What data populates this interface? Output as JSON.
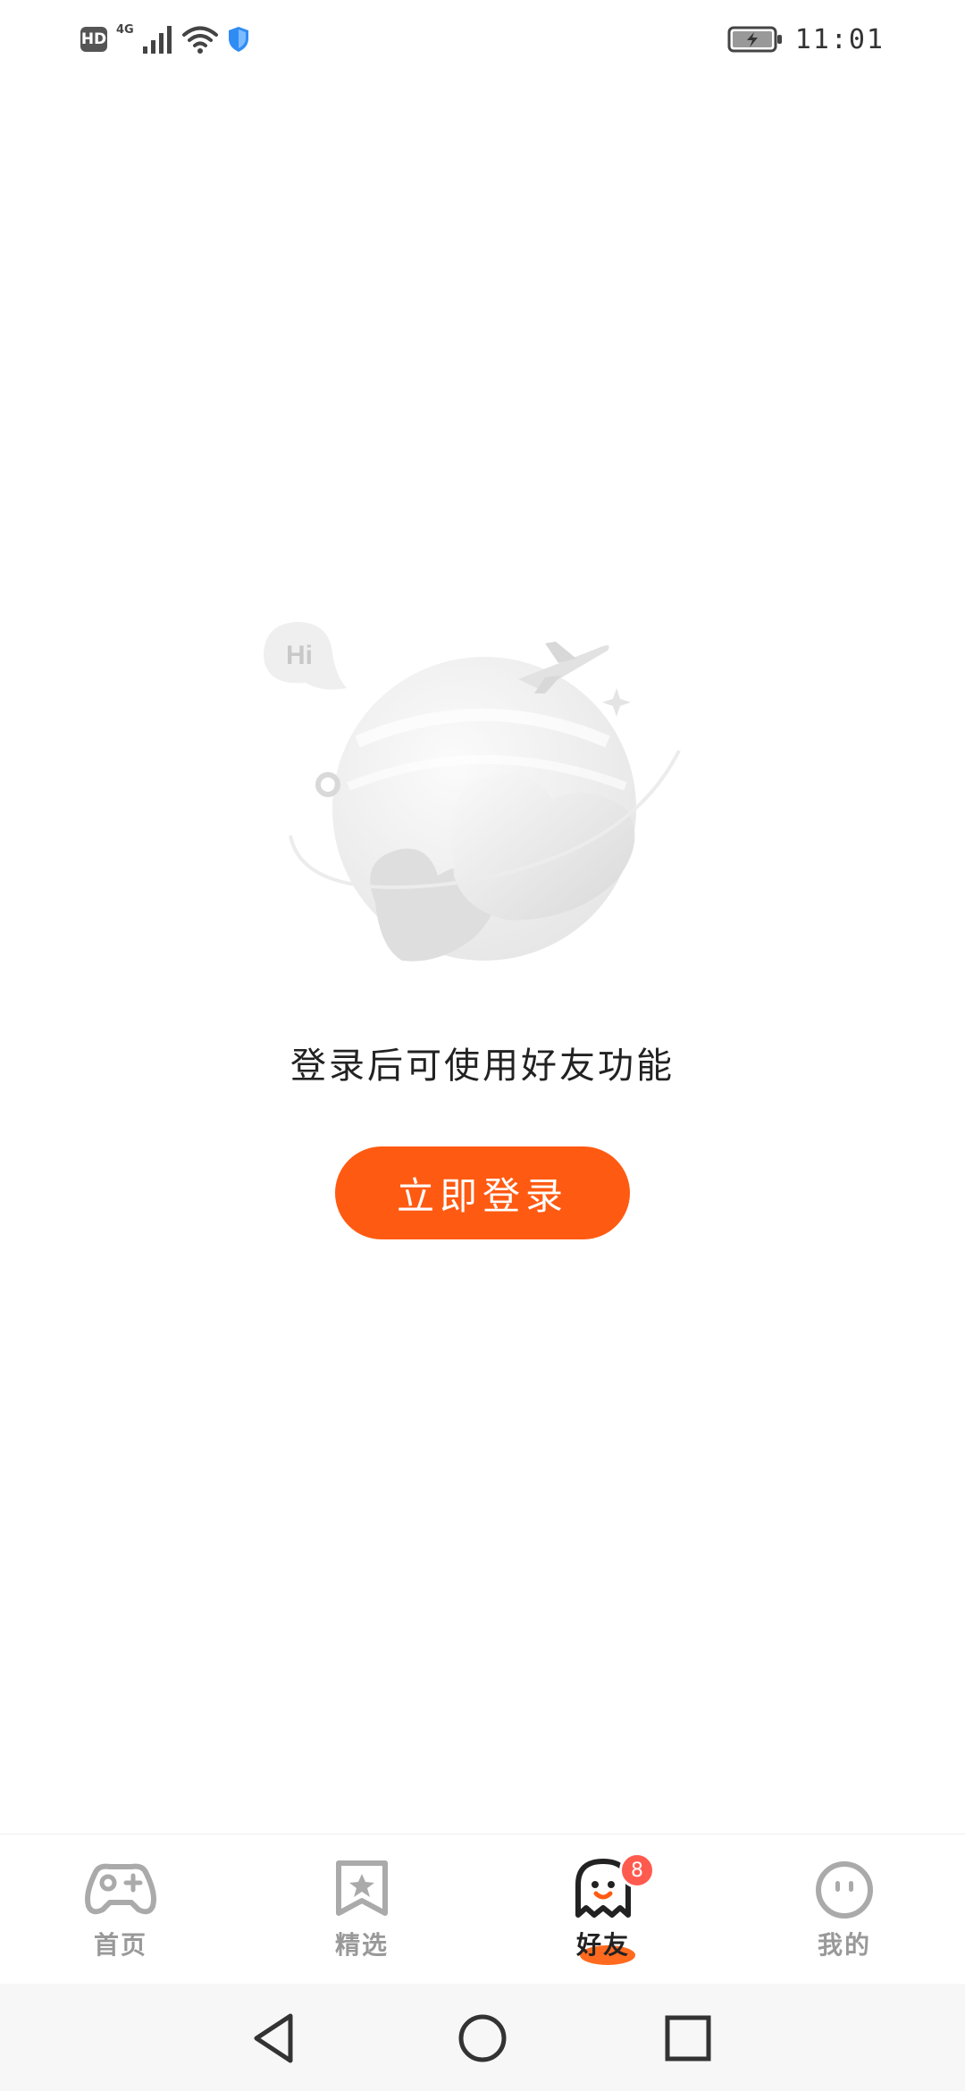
{
  "status_bar": {
    "hd_label": "HD",
    "network_label": "4G",
    "time": "11:01",
    "icons": [
      "hd-icon",
      "signal-icon",
      "wifi-icon",
      "shield-icon",
      "battery-charging-icon"
    ]
  },
  "illustration": {
    "bubble_text": "Hi",
    "icons": [
      "planet-icon",
      "airplane-icon",
      "sparkle-icon",
      "heart-icon",
      "speech-bubble-icon"
    ]
  },
  "main": {
    "prompt": "登录后可使用好友功能",
    "login_button": "立即登录"
  },
  "tabs": [
    {
      "label": "首页",
      "icon": "gamepad-icon",
      "active": false
    },
    {
      "label": "精选",
      "icon": "bookmark-star-icon",
      "active": false
    },
    {
      "label": "好友",
      "icon": "ghost-icon",
      "active": true,
      "badge": "8"
    },
    {
      "label": "我的",
      "icon": "face-icon",
      "active": false
    }
  ],
  "nav_bar": {
    "icons": [
      "back-triangle-icon",
      "home-circle-icon",
      "recent-square-icon"
    ]
  },
  "colors": {
    "accent": "#ff5a12",
    "badge": "#ff5a4e",
    "inactive_tab": "#999999"
  }
}
